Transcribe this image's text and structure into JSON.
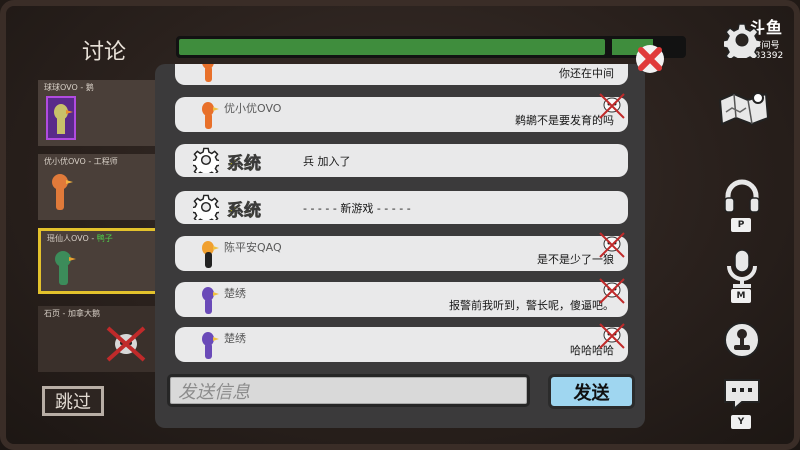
{
  "header": {
    "title": "讨论"
  },
  "timer": {
    "remaining_fraction": 0.94
  },
  "logo": {
    "brand": "斗鱼",
    "room_label": "房间号",
    "room_number": "983392"
  },
  "players": [
    {
      "name": "球球OVO",
      "role": "鹅",
      "role_color": "#d8d0c7",
      "avatar_color": "#c8c16a",
      "state": "portrait"
    },
    {
      "name": "优小优OVO",
      "role": "工程师",
      "role_color": "#d8d0c7",
      "avatar_color": "#e07a3a",
      "state": "alive"
    },
    {
      "name": "瑶仙人OVO",
      "role": "鸭子",
      "role_color": "#4fd14a",
      "avatar_color": "#3c8c5a",
      "state": "selected"
    },
    {
      "name": "石页",
      "role": "加拿大鹅",
      "role_color": "#d8d0c7",
      "avatar_color": "#cfcfcf",
      "state": "dead"
    }
  ],
  "skip_label": "跳过",
  "side_keys": {
    "voice": "P",
    "mic": "M",
    "chat": "Y"
  },
  "messages": [
    {
      "kind": "player",
      "name": "",
      "text": "你还在中间",
      "duck_color": "#e8702a"
    },
    {
      "kind": "player",
      "name": "优小优OVO",
      "text": "鹈鹕不是要发育的吗",
      "duck_color": "#e8702a"
    },
    {
      "kind": "system",
      "label": "系统",
      "text": "兵 加入了"
    },
    {
      "kind": "system",
      "label": "系统",
      "text": "- - - - - 新游戏 - - - - -"
    },
    {
      "kind": "player",
      "name": "陈平安QAQ",
      "text": "是不是少了一狼",
      "duck_color": "#f0a030"
    },
    {
      "kind": "player",
      "name": "楚绣",
      "text": "报警前我听到，警长呢，傻逼吧。",
      "duck_color": "#6a4ab8"
    },
    {
      "kind": "player",
      "name": "楚绣",
      "text": "哈哈哈哈",
      "duck_color": "#6a4ab8"
    }
  ],
  "input": {
    "placeholder": "发送信息",
    "value": ""
  },
  "send_label": "发送",
  "colors": {
    "chat_bg": "#3b3a3b",
    "send_bg": "#9fd6f0",
    "system_label": "#d9cf19",
    "timer_fill": "#3f8d3d",
    "close_red": "#e03a3a"
  }
}
